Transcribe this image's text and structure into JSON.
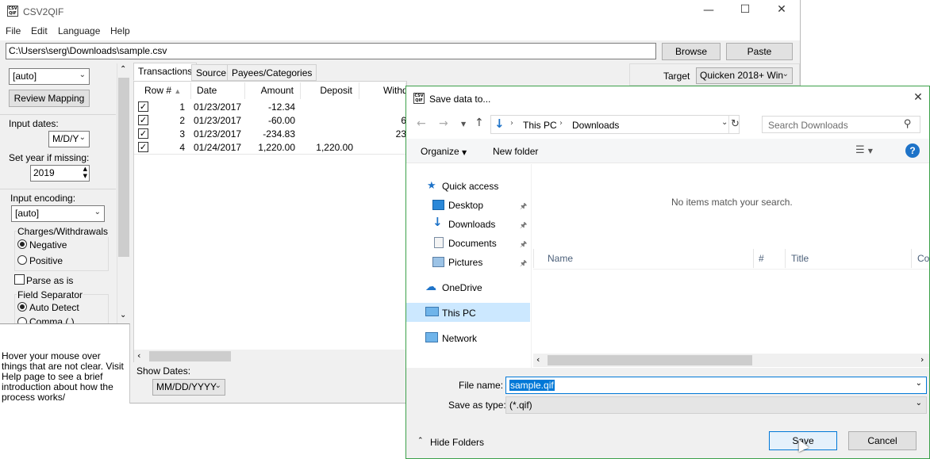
{
  "app": {
    "title": "CSV2QIF",
    "icon_text": "CSV QIF",
    "menu": [
      "File",
      "Edit",
      "Language",
      "Help"
    ],
    "path_value": "C:\\Users\\serg\\Downloads\\sample.csv",
    "browse_label": "Browse",
    "paste_label": "Paste",
    "target_label": "Target",
    "target_value": "Quicken 2018+ Win"
  },
  "left_panel": {
    "mapping_combo": "[auto]",
    "review_mapping_label": "Review Mapping",
    "input_dates_label": "Input dates:",
    "date_format": "M/D/Y",
    "set_year_label": "Set year if missing:",
    "year_value": "2019",
    "input_encoding_label": "Input encoding:",
    "encoding_value": "[auto]",
    "charges_group": "Charges/Withdrawals",
    "negative_label": "Negative",
    "positive_label": "Positive",
    "parse_as_is_label": "Parse as is",
    "field_sep_group": "Field Separator",
    "auto_detect_label": "Auto Detect",
    "comma_label": "Comma (,)",
    "help_text": "Hover your mouse over things that are not clear. Visit Help page to see a brief introduction about how the process works/"
  },
  "tabs": [
    "Transactions",
    "Source",
    "Payees/Categories"
  ],
  "table": {
    "headers": [
      "Row #",
      "Date",
      "Amount",
      "Deposit",
      "Withd"
    ],
    "rows": [
      {
        "row": "1",
        "date": "01/23/2017",
        "amount": "-12.34",
        "deposit": "",
        "withdrawal": ""
      },
      {
        "row": "2",
        "date": "01/23/2017",
        "amount": "-60.00",
        "deposit": "",
        "withdrawal": "6"
      },
      {
        "row": "3",
        "date": "01/23/2017",
        "amount": "-234.83",
        "deposit": "",
        "withdrawal": "23"
      },
      {
        "row": "4",
        "date": "01/24/2017",
        "amount": "1,220.00",
        "deposit": "1,220.00",
        "withdrawal": ""
      }
    ],
    "show_dates_label": "Show Dates:",
    "show_dates_value": "MM/DD/YYYY"
  },
  "dialog": {
    "title": "Save data to...",
    "breadcrumb": [
      "This PC",
      "Downloads"
    ],
    "search_placeholder": "Search Downloads",
    "organize_label": "Organize",
    "new_folder_label": "New folder",
    "nav_items": {
      "quick_access": "Quick access",
      "desktop": "Desktop",
      "downloads": "Downloads",
      "documents": "Documents",
      "pictures": "Pictures",
      "onedrive": "OneDrive",
      "this_pc": "This PC",
      "network": "Network"
    },
    "columns": [
      "Name",
      "#",
      "Title",
      "Co"
    ],
    "empty_message": "No items match your search.",
    "file_name_label": "File name:",
    "file_name_value": "sample.qif",
    "save_type_label": "Save as type:",
    "save_type_value": "(*.qif)",
    "hide_folders_label": "Hide Folders",
    "save_label": "Save",
    "cancel_label": "Cancel"
  },
  "colors": {
    "selection_blue": "#0078d7",
    "dialog_border": "#3ca04a",
    "help_blue": "#1e73c8"
  }
}
